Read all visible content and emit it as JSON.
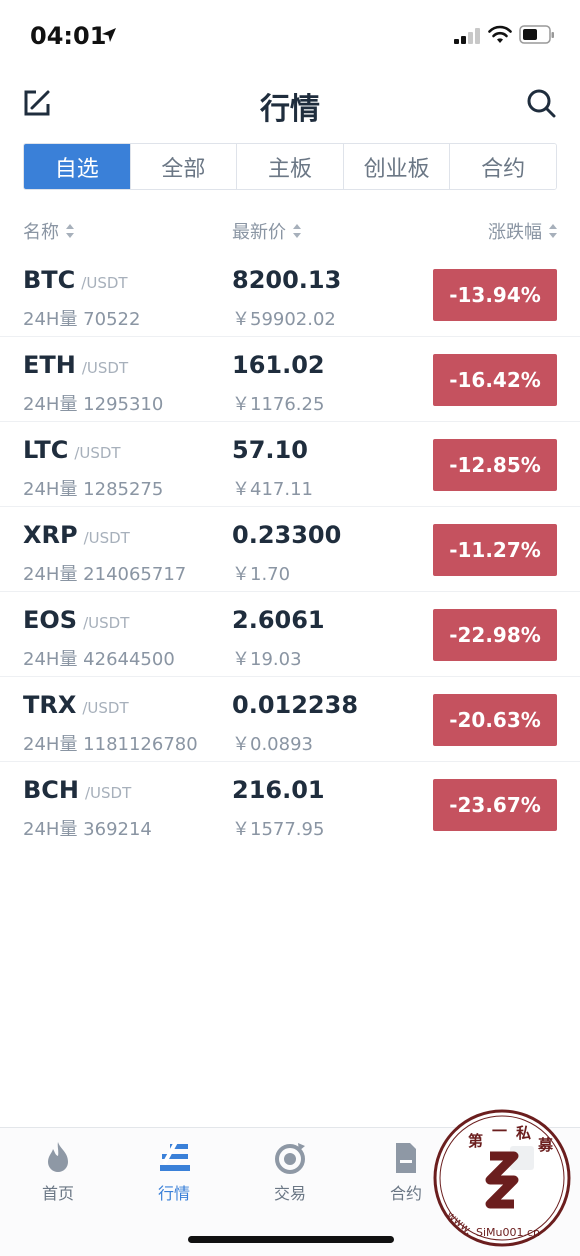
{
  "status_bar": {
    "time": "04:01"
  },
  "header": {
    "title": "行情"
  },
  "tabs": [
    {
      "label": "自选",
      "active": true
    },
    {
      "label": "全部",
      "active": false
    },
    {
      "label": "主板",
      "active": false
    },
    {
      "label": "创业板",
      "active": false
    },
    {
      "label": "合约",
      "active": false
    }
  ],
  "columns": {
    "name": "名称",
    "price": "最新价",
    "change": "涨跌幅"
  },
  "rows": [
    {
      "symbol": "BTC",
      "quote": "/USDT",
      "volume": "24H量 70522",
      "price": "8200.13",
      "cny": "￥59902.02",
      "change": "-13.94%"
    },
    {
      "symbol": "ETH",
      "quote": "/USDT",
      "volume": "24H量 1295310",
      "price": "161.02",
      "cny": "￥1176.25",
      "change": "-16.42%"
    },
    {
      "symbol": "LTC",
      "quote": "/USDT",
      "volume": "24H量 1285275",
      "price": "57.10",
      "cny": "￥417.11",
      "change": "-12.85%"
    },
    {
      "symbol": "XRP",
      "quote": "/USDT",
      "volume": "24H量 214065717",
      "price": "0.23300",
      "cny": "￥1.70",
      "change": "-11.27%"
    },
    {
      "symbol": "EOS",
      "quote": "/USDT",
      "volume": "24H量 42644500",
      "price": "2.6061",
      "cny": "￥19.03",
      "change": "-22.98%"
    },
    {
      "symbol": "TRX",
      "quote": "/USDT",
      "volume": "24H量 1181126780",
      "price": "0.012238",
      "cny": "￥0.0893",
      "change": "-20.63%"
    },
    {
      "symbol": "BCH",
      "quote": "/USDT",
      "volume": "24H量 369214",
      "price": "216.01",
      "cny": "￥1577.95",
      "change": "-23.67%"
    }
  ],
  "bottom_nav": [
    {
      "label": "首页",
      "icon": "flame-icon",
      "active": false
    },
    {
      "label": "行情",
      "icon": "chart-icon",
      "active": true
    },
    {
      "label": "交易",
      "icon": "exchange-icon",
      "active": false
    },
    {
      "label": "合约",
      "icon": "contract-icon",
      "active": false
    },
    {
      "label": "",
      "icon": "account-icon",
      "active": false
    }
  ],
  "watermark": {
    "text": "第一私募 www.SiMu001.cn"
  },
  "colors": {
    "accent": "#3a80d8",
    "negative": "#c5525f",
    "text": "#1f2d3d",
    "muted": "#8a95a3"
  }
}
